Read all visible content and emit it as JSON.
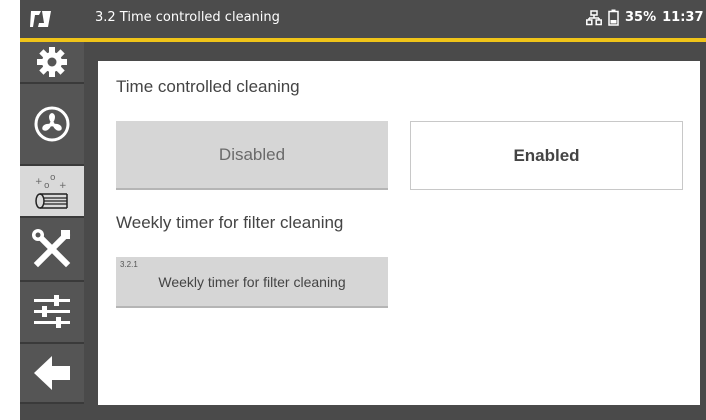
{
  "header": {
    "title": "3.2 Time controlled cleaning",
    "battery": "35%",
    "time": "11:37",
    "logo_icon": "brand-logo-icon",
    "network_icon": "network-icon",
    "battery_icon": "battery-icon"
  },
  "colors": {
    "accent": "#f0c419",
    "frame": "#4a4a4a",
    "sidebar": "#555555",
    "sidebar_active": "#d9d9d9",
    "button_off": "#d6d6d6"
  },
  "sidebar": {
    "items": [
      {
        "icon": "gear-icon",
        "active": false
      },
      {
        "icon": "fan-icon",
        "active": false
      },
      {
        "icon": "filter-cleaning-icon",
        "active": true
      },
      {
        "icon": "tools-icon",
        "active": false
      },
      {
        "icon": "sliders-icon",
        "active": false
      },
      {
        "icon": "back-arrow-icon",
        "active": false
      }
    ]
  },
  "main": {
    "section_title": "Time controlled cleaning",
    "options": [
      {
        "label": "Disabled",
        "selected": false
      },
      {
        "label": "Enabled",
        "selected": true
      }
    ],
    "timer_section_title": "Weekly timer for filter cleaning",
    "timer_button": {
      "index": "3.2.1",
      "label": "Weekly timer for filter cleaning"
    }
  }
}
